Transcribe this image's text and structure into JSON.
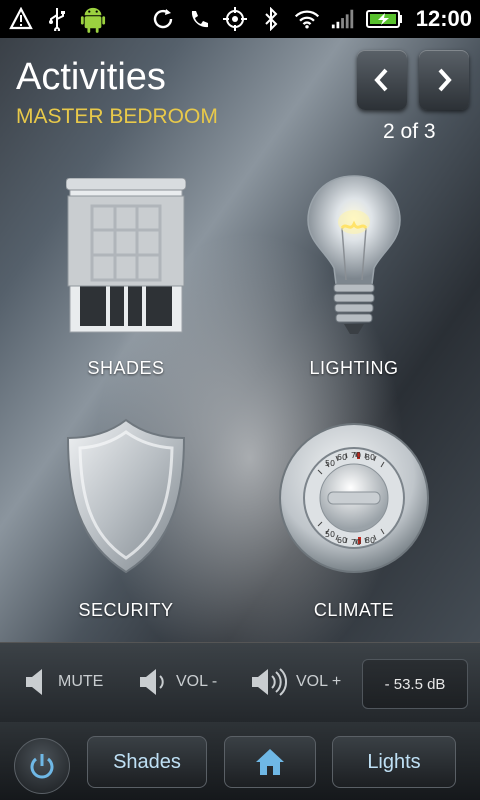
{
  "status_bar": {
    "time": "12:00",
    "icons": [
      "alert-icon",
      "usb-icon",
      "android-icon",
      "sync-icon",
      "call-icon",
      "gps-icon",
      "bluetooth-icon",
      "wifi-icon",
      "signal-icon",
      "battery-charging-icon"
    ]
  },
  "header": {
    "title": "Activities",
    "room": "MASTER BEDROOM",
    "pager": "2 of 3"
  },
  "tiles": [
    {
      "label": "SHADES",
      "icon": "window-shade-icon"
    },
    {
      "label": "LIGHTING",
      "icon": "lightbulb-icon"
    },
    {
      "label": "SECURITY",
      "icon": "shield-icon"
    },
    {
      "label": "CLIMATE",
      "icon": "thermostat-icon"
    }
  ],
  "thermostat_ticks": [
    "50",
    "60",
    "70",
    "80"
  ],
  "volume": {
    "mute": "MUTE",
    "vol_down": "VOL -",
    "vol_up": "VOL +",
    "level": "- 53.5 dB"
  },
  "bottom": {
    "left_button": "Shades",
    "right_button": "Lights",
    "home_icon": "home-icon",
    "power_icon": "power-icon"
  },
  "colors": {
    "accent_yellow": "#e8c94a",
    "button_text": "#bfe0f5"
  }
}
